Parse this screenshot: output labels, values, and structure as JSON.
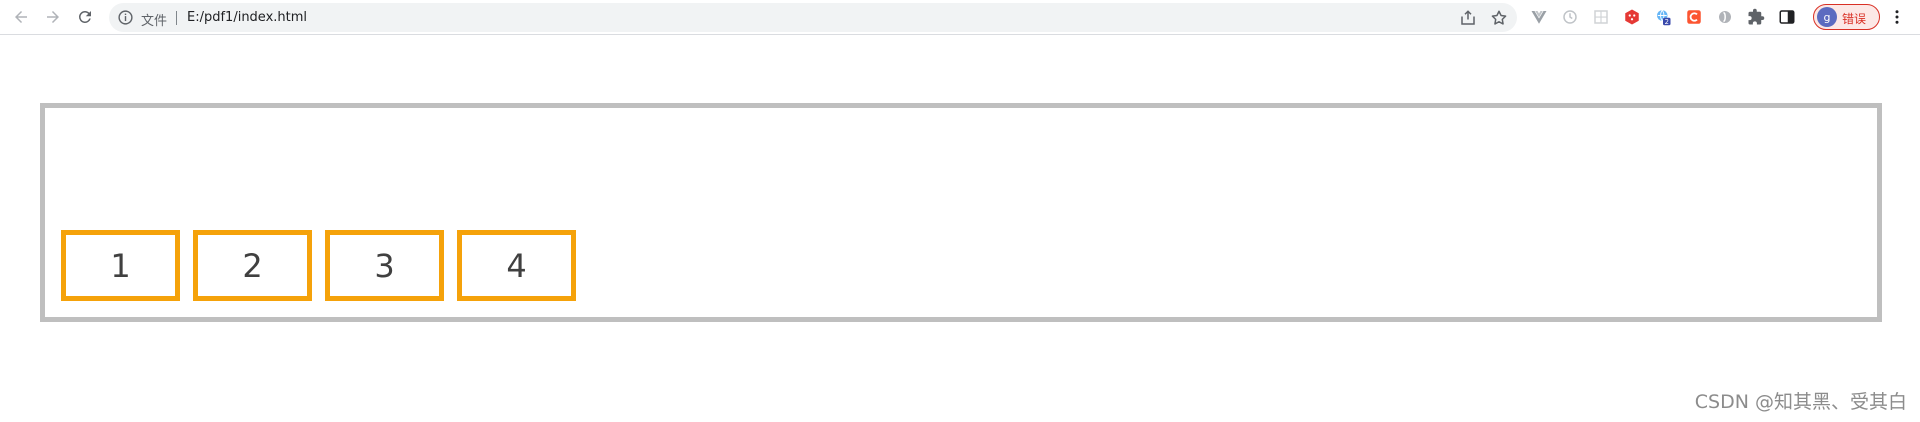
{
  "browser": {
    "address_label": "文件",
    "url": "E:/pdf1/index.html",
    "profile": {
      "avatar_letter": "g",
      "status_label": "错误"
    },
    "extension_badge": "2"
  },
  "page": {
    "items": [
      "1",
      "2",
      "3",
      "4"
    ]
  },
  "watermark": "CSDN @知其黑、受其白",
  "colors": {
    "item_border": "#f5a20a",
    "container_border": "#bfbfbf",
    "error_red": "#d93025"
  }
}
